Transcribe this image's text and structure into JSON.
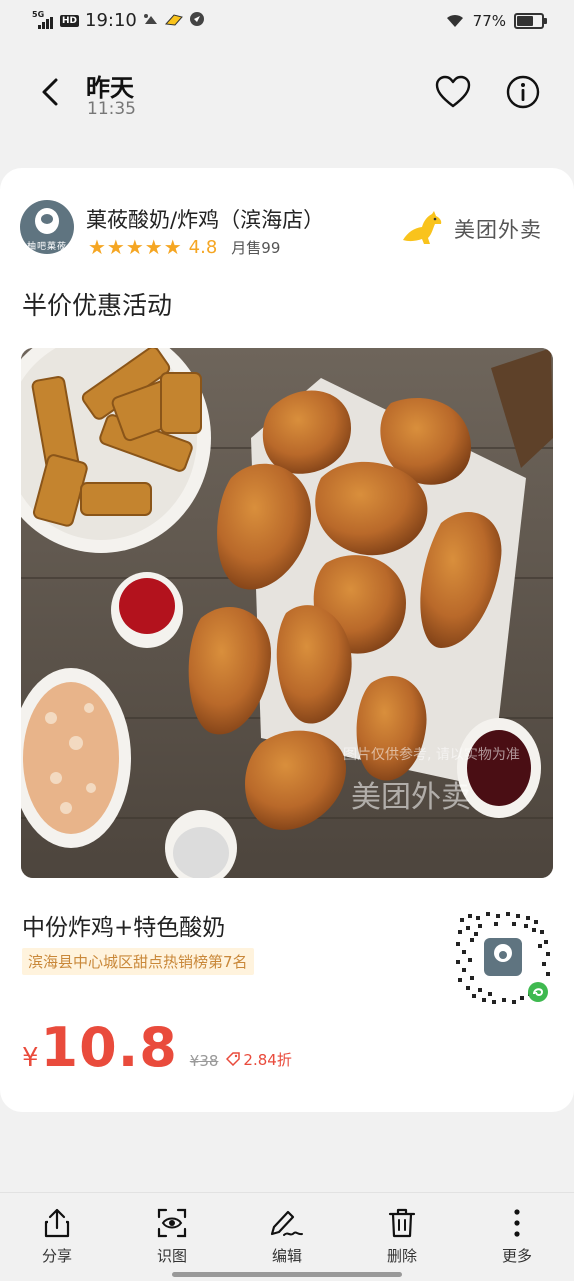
{
  "status_bar": {
    "network": "5G",
    "hd": "HD",
    "time": "19:10",
    "battery": "77%"
  },
  "header": {
    "title": "昨天",
    "subtitle": "11:35"
  },
  "card": {
    "shop_name": "菓莜酸奶/炸鸡（滨海店）",
    "stars": "★★★★★",
    "rating": "4.8",
    "monthly_sales": "月售99",
    "brand": "美团外卖",
    "logo_text": "柚吧菓莜",
    "promo_title": "半价优惠活动",
    "photo_note": "图片仅供参考, 请以实物为准",
    "photo_brand": "美团外卖",
    "product_name": "中份炸鸡+特色酸奶",
    "rank_badge": "滨海县中心城区甜点热销榜第7名",
    "currency": "¥",
    "price": "10.8",
    "original_price": "¥38",
    "discount": "2.84折"
  },
  "toolbar": {
    "items": [
      {
        "label": "分享",
        "icon": "share-icon"
      },
      {
        "label": "识图",
        "icon": "scan-image-icon"
      },
      {
        "label": "编辑",
        "icon": "edit-icon"
      },
      {
        "label": "删除",
        "icon": "trash-icon"
      },
      {
        "label": "更多",
        "icon": "more-icon"
      }
    ]
  },
  "colors": {
    "price_red": "#e94b3c",
    "star_orange": "#f5a623",
    "rank_text": "#c9883a",
    "rank_bg": "#fff3dd",
    "meituan_yellow": "#f9c31c"
  }
}
